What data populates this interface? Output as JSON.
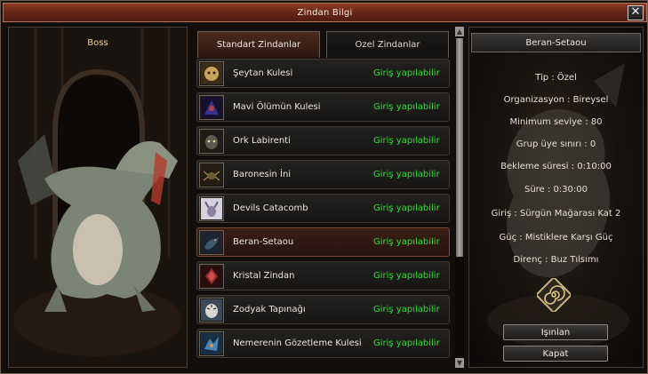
{
  "window": {
    "title": "Zindan Bilgi",
    "close_label": "✕"
  },
  "boss_panel": {
    "label": "Boss"
  },
  "tabs": [
    {
      "label": "Standart Zindanlar",
      "active": true
    },
    {
      "label": "Ozel Zindanlar",
      "active": false
    }
  ],
  "dungeons": [
    {
      "name": "Şeytan Kulesi",
      "status": "Giriş yapılabilir",
      "icon": "demon-face-icon",
      "color": "#c9a45a"
    },
    {
      "name": "Mavi Ölümün Kulesi",
      "status": "Giriş yapılabilir",
      "icon": "blue-demon-icon",
      "color": "#3a2f8a"
    },
    {
      "name": "Ork Labirenti",
      "status": "Giriş yapılabilir",
      "icon": "orc-icon",
      "color": "#5c5a50"
    },
    {
      "name": "Baronesin İni",
      "status": "Giriş yapılabilir",
      "icon": "spider-icon",
      "color": "#6e5a36"
    },
    {
      "name": "Devils Catacomb",
      "status": "Giriş yapılabilir",
      "icon": "horned-devil-icon",
      "color": "#b5b0c8"
    },
    {
      "name": "Beran-Setaou",
      "status": "Giriş yapılabilir",
      "icon": "dragon-icon",
      "color": "#3f5a6e",
      "selected": true
    },
    {
      "name": "Kristal Zindan",
      "status": "Giriş yapılabilir",
      "icon": "crystal-beast-icon",
      "color": "#9a2a2a"
    },
    {
      "name": "Zodyak Tapınağı",
      "status": "Giriş yapılabilir",
      "icon": "tiger-icon",
      "color": "#d8d8d0"
    },
    {
      "name": "Nemerenin Gözetleme Kulesi",
      "status": "Giriş yapılabilir",
      "icon": "ice-beast-icon",
      "color": "#4a86b8"
    }
  ],
  "detail": {
    "title": "Beran-Setaou",
    "lines": [
      "Tip : Özel",
      "Organizasyon : Bireysel",
      "Minimum seviye : 80",
      "Grup üye sınırı : 0",
      "Bekleme süresi : 0:10:00",
      "Süre : 0:30:00",
      "Giriş : Sürgün Mağarası Kat 2",
      "Güç : Mistiklere Karşı Güç",
      "Direnç : Buz Tılsımı"
    ],
    "icon": "spiral-rune-icon",
    "teleport_label": "Işınlan",
    "close_label": "Kapat"
  },
  "colors": {
    "status_green": "#2ee02e",
    "title_bar": "#6b2818",
    "boss_label": "#f1d27a"
  }
}
